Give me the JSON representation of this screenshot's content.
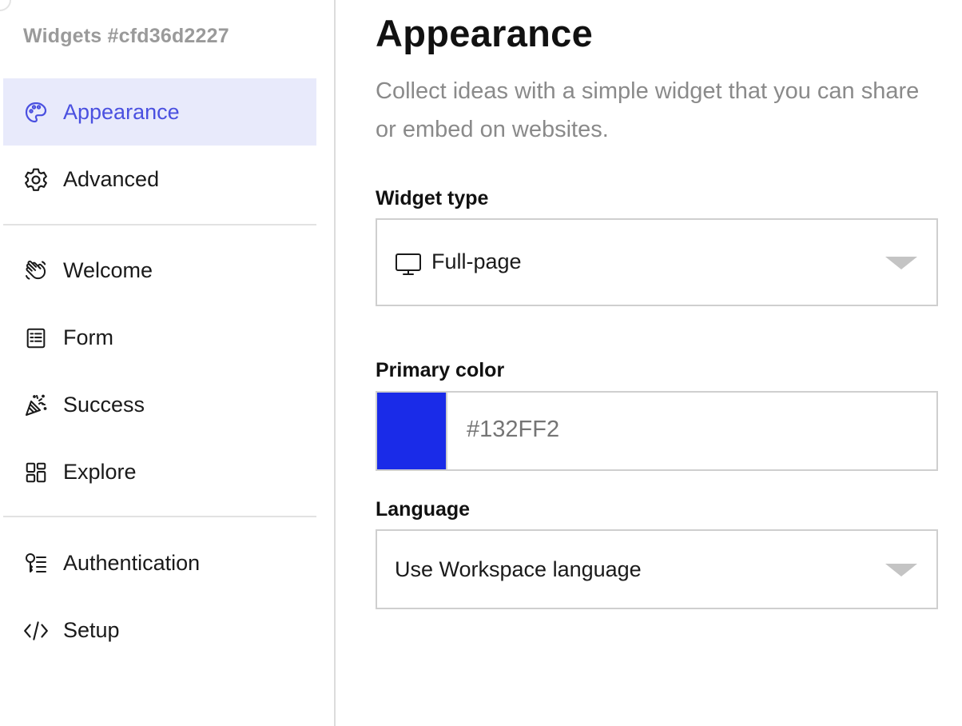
{
  "sidebar": {
    "title": "Widgets #cfd36d2227",
    "items": [
      {
        "label": "Appearance",
        "icon": "palette-icon",
        "active": true
      },
      {
        "label": "Advanced",
        "icon": "gear-icon"
      },
      {
        "label": "Welcome",
        "icon": "wave-hand-icon"
      },
      {
        "label": "Form",
        "icon": "form-icon"
      },
      {
        "label": "Success",
        "icon": "party-popper-icon"
      },
      {
        "label": "Explore",
        "icon": "grid-icon"
      },
      {
        "label": "Authentication",
        "icon": "key-list-icon"
      },
      {
        "label": "Setup",
        "icon": "code-icon"
      }
    ]
  },
  "main": {
    "title": "Appearance",
    "description": "Collect ideas with a simple widget that you can share or embed on websites.",
    "widget_type": {
      "label": "Widget type",
      "value": "Full-page",
      "icon": "monitor-icon"
    },
    "primary_color": {
      "label": "Primary color",
      "value": "#132FF2",
      "swatch": "#1a2be8"
    },
    "language": {
      "label": "Language",
      "value": "Use Workspace language"
    }
  },
  "colors": {
    "accent": "#4a50e0",
    "active_bg": "#e8eafb"
  }
}
